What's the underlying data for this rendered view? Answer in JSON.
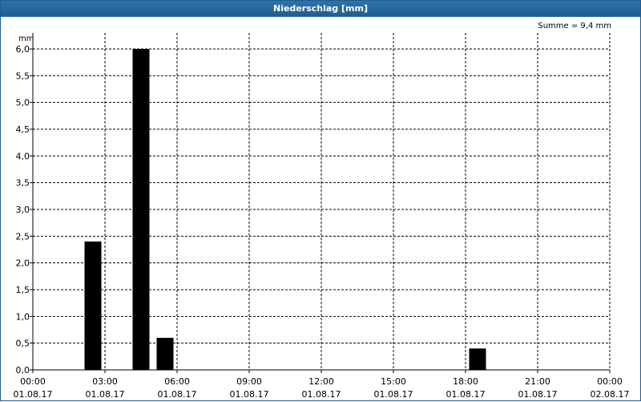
{
  "window": {
    "title": "Niederschlag [mm]"
  },
  "summary": {
    "label": "Summe = 9,4 mm"
  },
  "chart_data": {
    "type": "bar",
    "title": "Niederschlag [mm]",
    "ylabel": "mm",
    "xlabel": "",
    "ylim": [
      0,
      6.0
    ],
    "yticks": [
      "0,0",
      "0,5",
      "1,0",
      "1,5",
      "2,0",
      "2,5",
      "3,0",
      "3,5",
      "4,0",
      "4,5",
      "5,0",
      "5,5",
      "6,0"
    ],
    "xlim_hours": [
      0,
      24
    ],
    "xticks": [
      {
        "time": "00:00",
        "date": "01.08.17"
      },
      {
        "time": "03:00",
        "date": "01.08.17"
      },
      {
        "time": "06:00",
        "date": "01.08.17"
      },
      {
        "time": "09:00",
        "date": "01.08.17"
      },
      {
        "time": "12:00",
        "date": "01.08.17"
      },
      {
        "time": "15:00",
        "date": "01.08.17"
      },
      {
        "time": "18:00",
        "date": "01.08.17"
      },
      {
        "time": "21:00",
        "date": "01.08.17"
      },
      {
        "time": "00:00",
        "date": "02.08.17"
      }
    ],
    "bars": [
      {
        "time": "02:30",
        "value": 2.4
      },
      {
        "time": "04:30",
        "value": 6.0
      },
      {
        "time": "05:30",
        "value": 0.6
      },
      {
        "time": "18:30",
        "value": 0.4
      }
    ],
    "bar_color": "#000000",
    "grid": true
  }
}
